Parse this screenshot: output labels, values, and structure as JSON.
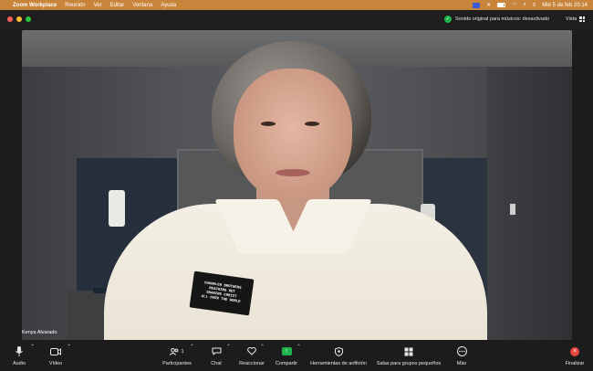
{
  "menubar": {
    "apple_icon": "apple-icon",
    "app_name": "Zoom Workplace",
    "menus": [
      "Reunión",
      "Ver",
      "Editar",
      "Ventana",
      "Ayuda"
    ],
    "datetime": "Mié 5 de feb  20:14"
  },
  "titlebar": {
    "sound_status": "Sonido original para músicos: desactivado",
    "view_label": "Vista"
  },
  "participant_name": "Kenya Alvarado",
  "badge_text": [
    "CHANDLER BROTHERS",
    "REACHING OUT",
    "SHARING CHRIST",
    "ALL OVER THE WORLD"
  ],
  "toolbar": {
    "audio": "Audio",
    "video": "Vídeo",
    "participants": "Participantes",
    "participant_count": "1",
    "chat": "Chat",
    "react": "Reaccionar",
    "share": "Compartir",
    "host_tools": "Herramientas de anfitrión",
    "breakout": "Salas para grupos pequeños",
    "more": "Más",
    "end": "Finalizar"
  },
  "colors": {
    "menubar_bg": "#c8843a",
    "share_green": "#1fb34b",
    "end_red": "#e5453d"
  }
}
